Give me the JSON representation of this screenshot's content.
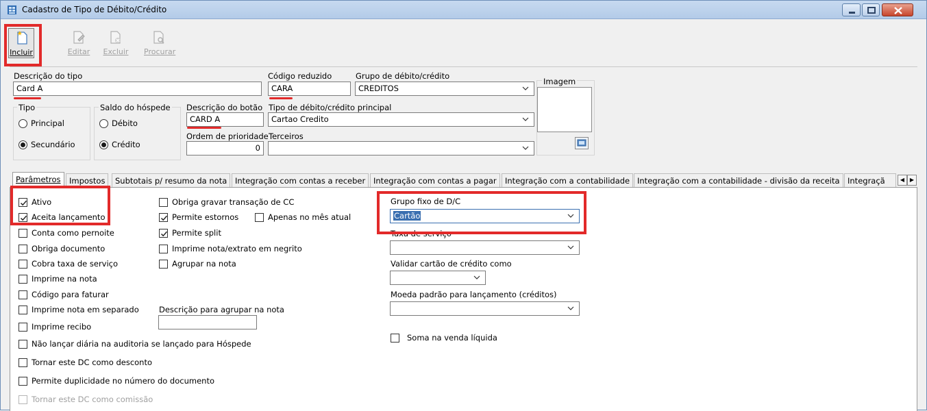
{
  "window": {
    "title": "Cadastro de Tipo de Débito/Crédito"
  },
  "toolbar": {
    "include": "Incluir",
    "edit": "Editar",
    "delete": "Excluir",
    "search": "Procurar"
  },
  "header": {
    "descricao_label": "Descrição do tipo",
    "descricao_value": "Card A",
    "codigo_label": "Código reduzido",
    "codigo_value": "CARA",
    "grupo_label": "Grupo de débito/crédito",
    "grupo_value": "CREDITOS",
    "imagem_label": "Imagem",
    "tipo_label": "Tipo",
    "tipo_principal": "Principal",
    "tipo_secundario": "Secundário",
    "saldo_label": "Saldo do hóspede",
    "saldo_debito": "Débito",
    "saldo_credito": "Crédito",
    "botao_label": "Descrição do botão",
    "botao_value": "CARD A",
    "tipo_principal_label": "Tipo de débito/crédito principal",
    "tipo_principal_value": "Cartao Credito",
    "ordem_label": "Ordem de prioridade",
    "ordem_value": "0",
    "terceiros_label": "Terceiros",
    "terceiros_value": ""
  },
  "tabs": [
    "Parâmetros",
    "Impostos",
    "Subtotais p/ resumo da nota",
    "Integração com contas a receber",
    "Integração com contas a pagar",
    "Integração com a contabilidade",
    "Integração com a contabilidade - divisão da receita",
    "Integraçã"
  ],
  "params": {
    "col1": [
      "Ativo",
      "Aceita lançamento",
      "Conta como pernoite",
      "Obriga documento",
      "Cobra taxa de serviço",
      "Imprime na nota",
      "Código para faturar",
      "Imprime nota em separado",
      "Imprime recibo",
      "Não lançar diária na auditoria se lançado para Hóspede",
      "Tornar este DC como desconto",
      "Permite duplicidade no número do documento",
      "Tornar este DC como comissão"
    ],
    "col1_checked": [
      true,
      true,
      false,
      false,
      false,
      false,
      false,
      false,
      false,
      false,
      false,
      false,
      false
    ],
    "col2": [
      "Obriga gravar transação de CC",
      "Permite estornos",
      "Permite split",
      "Imprime nota/extrato em negrito",
      "Agrupar na nota"
    ],
    "col2_checked": [
      false,
      true,
      true,
      false,
      false
    ],
    "apenas_mes": "Apenas no mês atual",
    "descricao_agrupar_label": "Descrição para agrupar na nota",
    "grupo_fixo_label": "Grupo fixo de D/C",
    "grupo_fixo_value": "Cartão",
    "taxa_label": "Taxa de serviço",
    "validar_label": "Validar cartão de crédito como",
    "moeda_label": "Moeda padrão para lançamento (créditos)",
    "soma_label": "Soma na venda líquida"
  }
}
